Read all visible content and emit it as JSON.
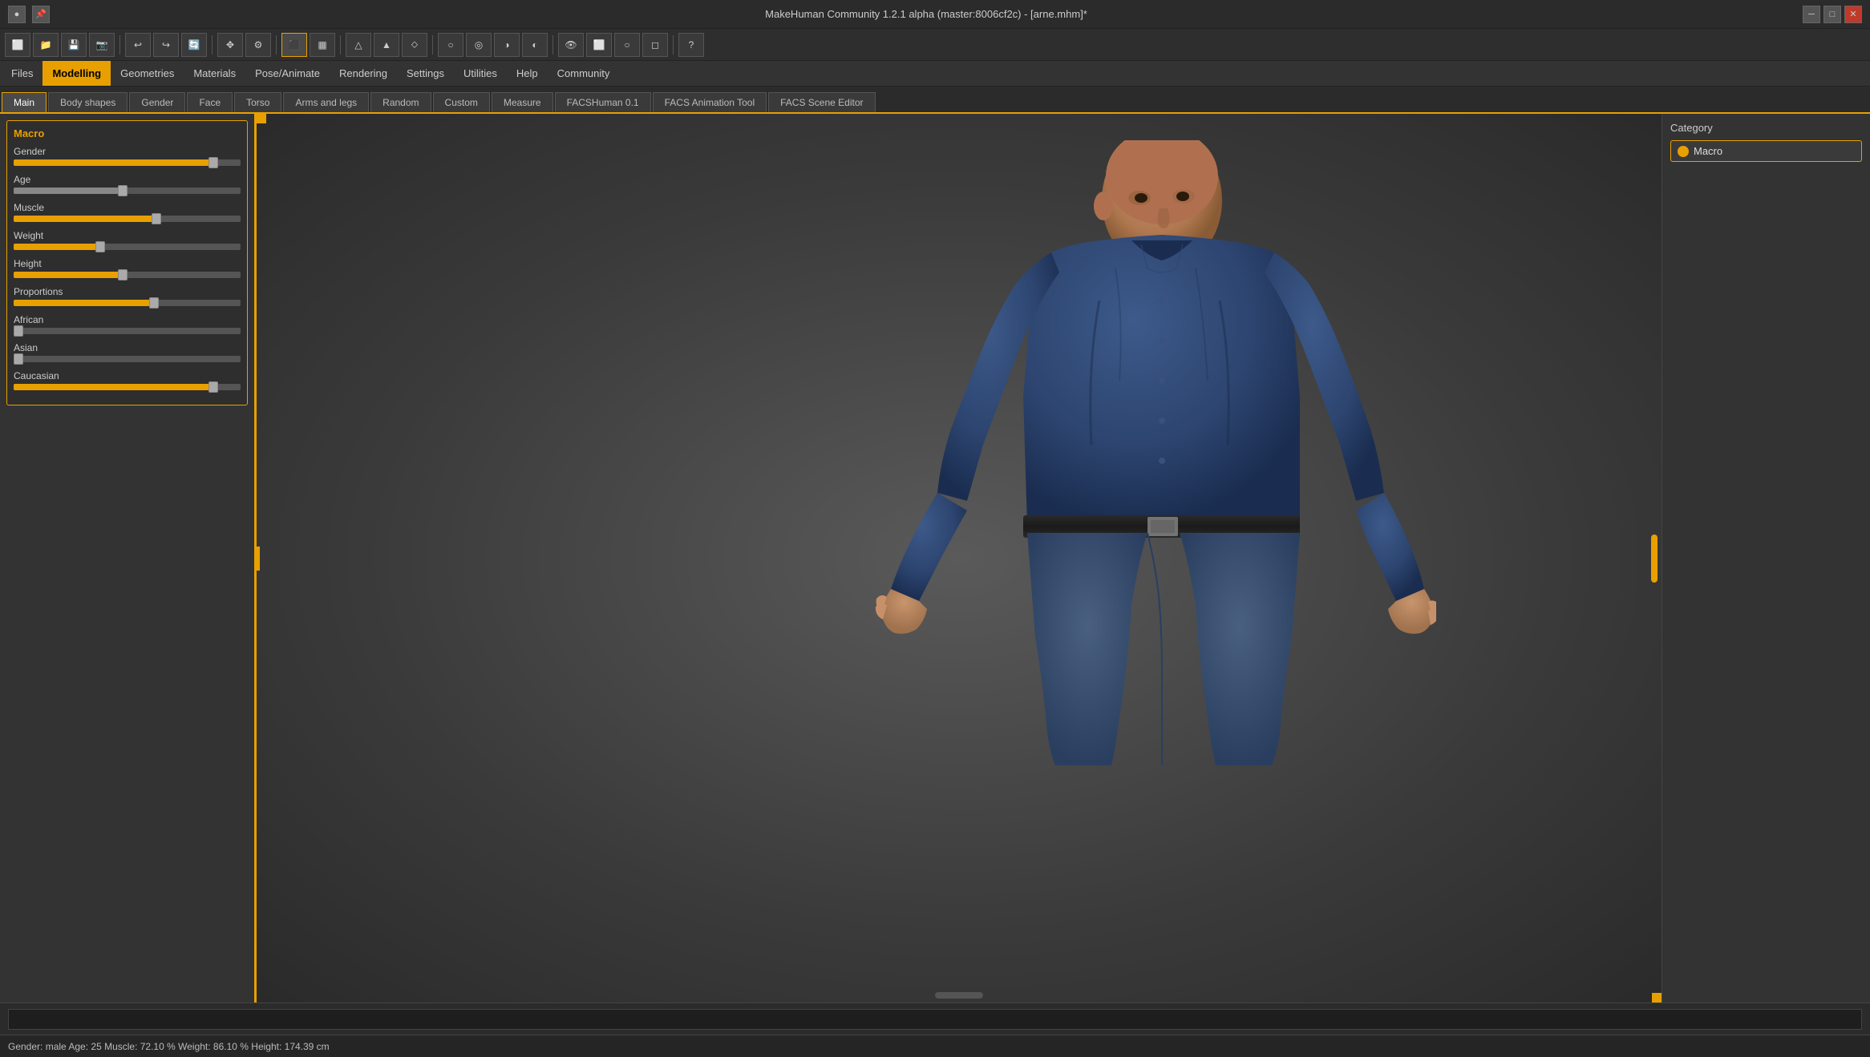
{
  "app": {
    "title": "MakeHuman Community 1.2.1 alpha (master:8006cf2c) - [arne.mhm]*"
  },
  "menu": {
    "items": [
      "Files",
      "Modelling",
      "Geometries",
      "Materials",
      "Pose/Animate",
      "Rendering",
      "Settings",
      "Utilities",
      "Help",
      "Community"
    ],
    "active": "Modelling"
  },
  "tabs": {
    "items": [
      "Main",
      "Body shapes",
      "Gender",
      "Face",
      "Torso",
      "Arms and legs",
      "Random",
      "Custom",
      "Measure",
      "FACSHuman 0.1",
      "FACS Animation Tool",
      "FACS Scene Editor"
    ],
    "active": "Main"
  },
  "macro": {
    "title": "Macro",
    "sliders": [
      {
        "label": "Gender",
        "fill": 88,
        "thumb": 86
      },
      {
        "label": "Age",
        "fill": 48,
        "thumb": 47
      },
      {
        "label": "Muscle",
        "fill": 63,
        "thumb": 62
      },
      {
        "label": "Weight",
        "fill": 38,
        "thumb": 37
      },
      {
        "label": "Height",
        "fill": 48,
        "thumb": 47
      },
      {
        "label": "Proportions",
        "fill": 60,
        "thumb": 59
      },
      {
        "label": "African",
        "fill": 3,
        "thumb": 2
      },
      {
        "label": "Asian",
        "fill": 3,
        "thumb": 2
      },
      {
        "label": "Caucasian",
        "fill": 88,
        "thumb": 86
      }
    ]
  },
  "category": {
    "title": "Category",
    "items": [
      {
        "label": "Macro",
        "active": true
      }
    ]
  },
  "statusbar": {
    "text": "Gender: male  Age: 25  Muscle: 72.10 %  Weight: 86.10 %  Height: 174.39 cm"
  },
  "toolbar": {
    "buttons": [
      {
        "icon": "●",
        "label": "app-icon"
      },
      {
        "icon": "📌",
        "label": "pin"
      },
      {
        "icon": "⬜",
        "label": "new"
      },
      {
        "icon": "📂",
        "label": "open"
      },
      {
        "icon": "💾",
        "label": "save"
      },
      {
        "icon": "📷",
        "label": "screenshot"
      },
      {
        "icon": "↩",
        "label": "undo"
      },
      {
        "icon": "↪",
        "label": "redo"
      },
      {
        "icon": "🔄",
        "label": "refresh"
      },
      {
        "icon": "✥",
        "label": "move"
      },
      {
        "icon": "⚙",
        "label": "settings"
      },
      {
        "icon": "⬛",
        "label": "grid1",
        "active": true
      },
      {
        "icon": "▦",
        "label": "grid2"
      },
      {
        "icon": "△",
        "label": "tri1"
      },
      {
        "icon": "△",
        "label": "tri2"
      },
      {
        "icon": "△",
        "label": "tri3"
      },
      {
        "icon": "○",
        "label": "sphere1"
      },
      {
        "icon": "○",
        "label": "sphere2"
      },
      {
        "icon": "○",
        "label": "sphere3"
      },
      {
        "icon": "○",
        "label": "sphere4"
      },
      {
        "icon": "👁",
        "label": "eye"
      },
      {
        "icon": "⬜",
        "label": "box"
      },
      {
        "icon": "○",
        "label": "circ"
      },
      {
        "icon": "⬜",
        "label": "sq"
      },
      {
        "icon": "?",
        "label": "help"
      }
    ]
  }
}
